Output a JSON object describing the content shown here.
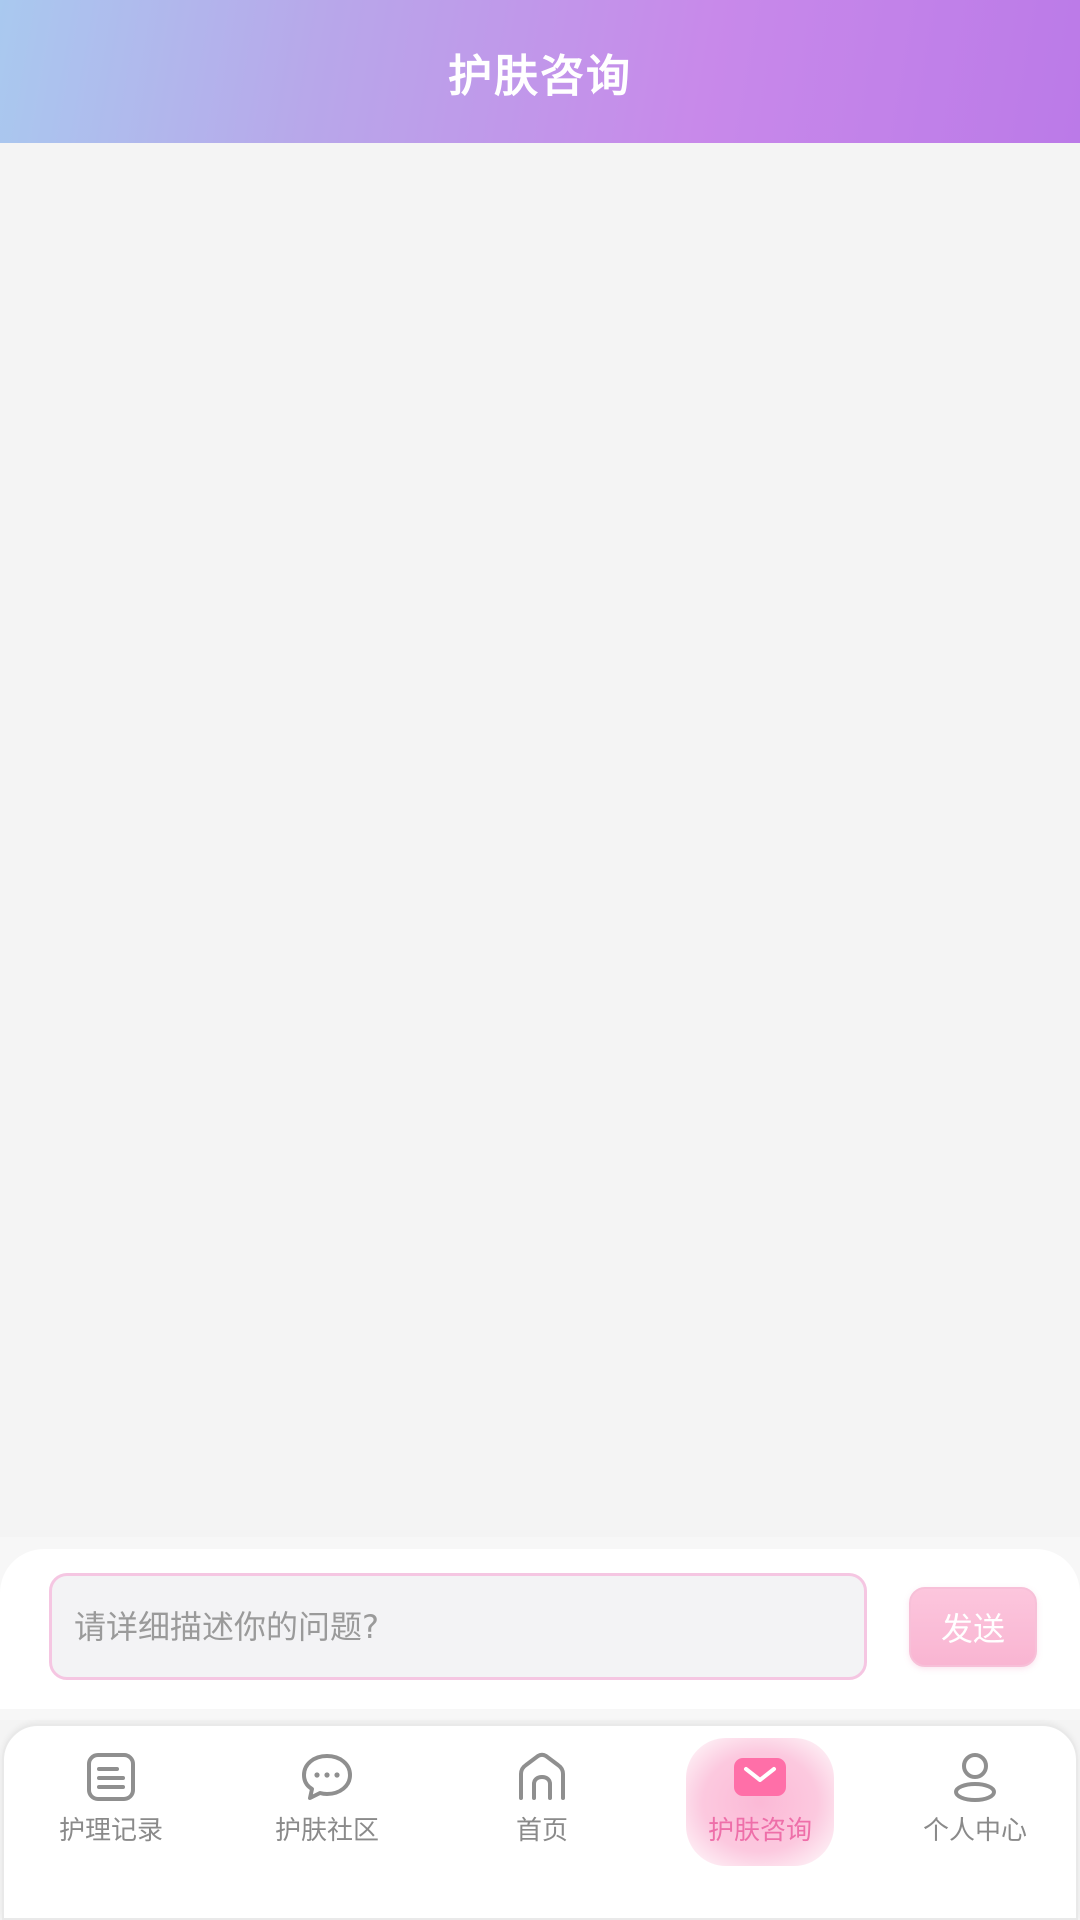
{
  "header": {
    "title": "护肤咨询"
  },
  "composer": {
    "placeholder": "请详细描述你的问题?",
    "send_label": "发送"
  },
  "bottom_nav": {
    "items": [
      {
        "label": "护理记录",
        "icon": "notes-icon"
      },
      {
        "label": "护肤社区",
        "icon": "chat-bubble-icon"
      },
      {
        "label": "首页",
        "icon": "home-icon"
      },
      {
        "label": "护肤咨询",
        "icon": "mail-icon",
        "active": true
      },
      {
        "label": "个人中心",
        "icon": "user-icon"
      }
    ]
  },
  "colors": {
    "accent": "#ee6fa9",
    "header_gradient_start": "#a9c9ef",
    "header_gradient_end": "#bb7ae8",
    "input_border": "#f5c6e2",
    "send_button": "#f9b5d2"
  }
}
